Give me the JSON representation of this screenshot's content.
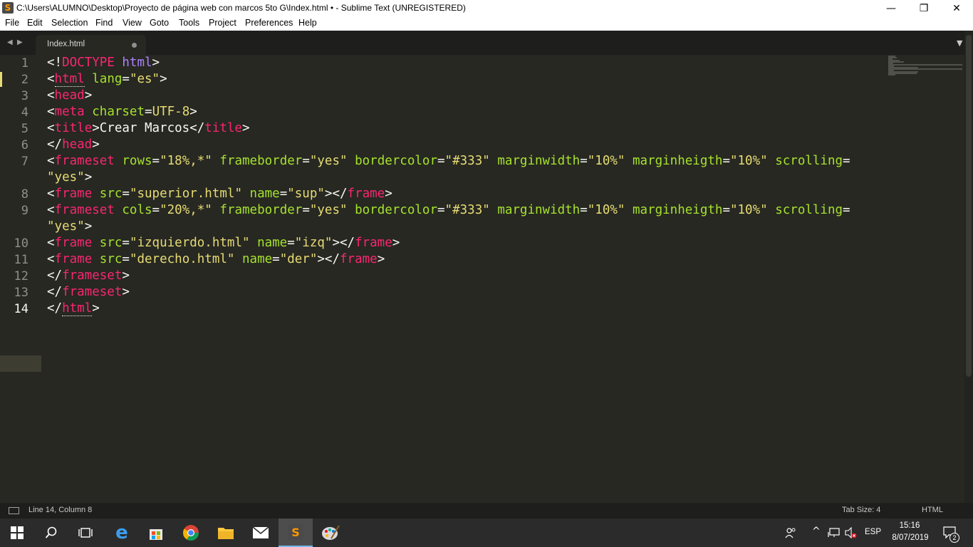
{
  "window": {
    "title": "C:\\Users\\ALUMNO\\Desktop\\Proyecto de página web con marcos 5to G\\Index.html • - Sublime Text (UNREGISTERED)",
    "minimize_glyph": "—",
    "maximize_glyph": "❐",
    "close_glyph": "✕"
  },
  "menu": {
    "items": [
      "File",
      "Edit",
      "Selection",
      "Find",
      "View",
      "Goto",
      "Tools",
      "Project",
      "Preferences",
      "Help"
    ]
  },
  "tabs": [
    {
      "label": "Index.html",
      "modified": true,
      "active": true
    }
  ],
  "editor": {
    "line_numbers": [
      "1",
      "2",
      "3",
      "4",
      "5",
      "6",
      "7",
      "",
      "8",
      "9",
      "",
      "10",
      "11",
      "12",
      "13",
      "14"
    ],
    "current_line": "14"
  },
  "status": {
    "position": "Line 14, Column 8",
    "tab_size": "Tab Size: 4",
    "syntax": "HTML"
  },
  "taskbar": {
    "apps": [
      "windows-start",
      "search",
      "task-view",
      "edge",
      "store",
      "chrome",
      "file-explorer",
      "mail",
      "sublime-text",
      "paint"
    ],
    "active_app": "sublime-text",
    "tray": {
      "language": "ESP",
      "time": "15:16",
      "date": "8/07/2019",
      "notifications": "2"
    }
  },
  "colors": {
    "editor_bg": "#272822",
    "tag": "#f92672",
    "attribute": "#a6e22e",
    "string": "#e6db74",
    "keyword": "#ae81ff",
    "plain": "#f8f8f2"
  }
}
